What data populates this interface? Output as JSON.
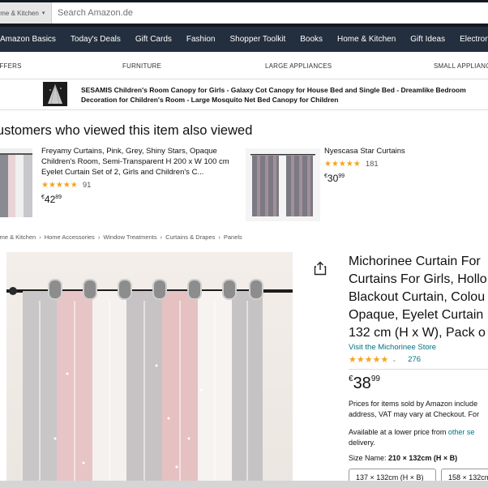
{
  "search": {
    "category": "Home & Kitchen",
    "placeholder": "Search Amazon.de"
  },
  "main_nav": [
    "Amazon Basics",
    "Today's Deals",
    "Gift Cards",
    "Fashion",
    "Shopper Toolkit",
    "Books",
    "Home & Kitchen",
    "Gift Ideas",
    "Electronics & Photo"
  ],
  "sub_nav": [
    "OFFERS",
    "FURNITURE",
    "LARGE APPLIANCES",
    "SMALL APPLIANCES"
  ],
  "banner": {
    "text": "SESAMIS Children's Room Canopy for Girls - Galaxy Cot Canopy for House Bed and Single Bed - Dreamlike Bedroom Decoration for Children's Room - Large Mosquito Net Bed Canopy for Children"
  },
  "also_viewed": {
    "title": "Customers who viewed this item also viewed",
    "items": [
      {
        "title": "Freyamy Curtains, Pink, Grey, Shiny Stars, Opaque Children's Room, Semi-Transparent H 200 x W 100 cm Eyelet Curtain Set of 2, Girls and Children's C...",
        "stars": "★★★★★",
        "rating": 4.5,
        "reviews": "91",
        "price_currency": "€",
        "price_whole": "42",
        "price_cents": "89"
      },
      {
        "title": "Nyescasa Star Curtains",
        "stars": "★★★★★",
        "rating": 4.5,
        "reviews": "181",
        "price_currency": "€",
        "price_whole": "30",
        "price_cents": "99"
      }
    ]
  },
  "breadcrumb": [
    "Home & Kitchen",
    "Home Accessories",
    "Window Treatments",
    "Curtains & Drapes",
    "Panels"
  ],
  "product": {
    "title_lines": [
      "Michorinee Curtain For",
      "Curtains For Girls, Hollo",
      "Blackout Curtain, Colou",
      "Opaque, Eyelet Curtain",
      "132 cm (H x W), Pack o"
    ],
    "store": "Visit the Michorinee Store",
    "stars": "★★★★★",
    "rating": 4.0,
    "reviews": "276",
    "price_currency": "€",
    "price_whole": "38",
    "price_cents": "99",
    "vat_note_1": "Prices for items sold by Amazon include",
    "vat_note_2": "address, VAT may vary at Checkout. For",
    "lower_price_1": "Available at a lower price from",
    "lower_price_link": "other se",
    "lower_price_2": "delivery.",
    "size_label": "Size Name:",
    "size_value": "210 × 132cm (H × B)",
    "size_options": [
      "137 × 132cm (H × B)",
      "158 × 132cm"
    ]
  },
  "colors": {
    "header_bg": "#131921",
    "nav_bg": "#232f3e",
    "link": "#007185",
    "star": "#f4a41d"
  }
}
